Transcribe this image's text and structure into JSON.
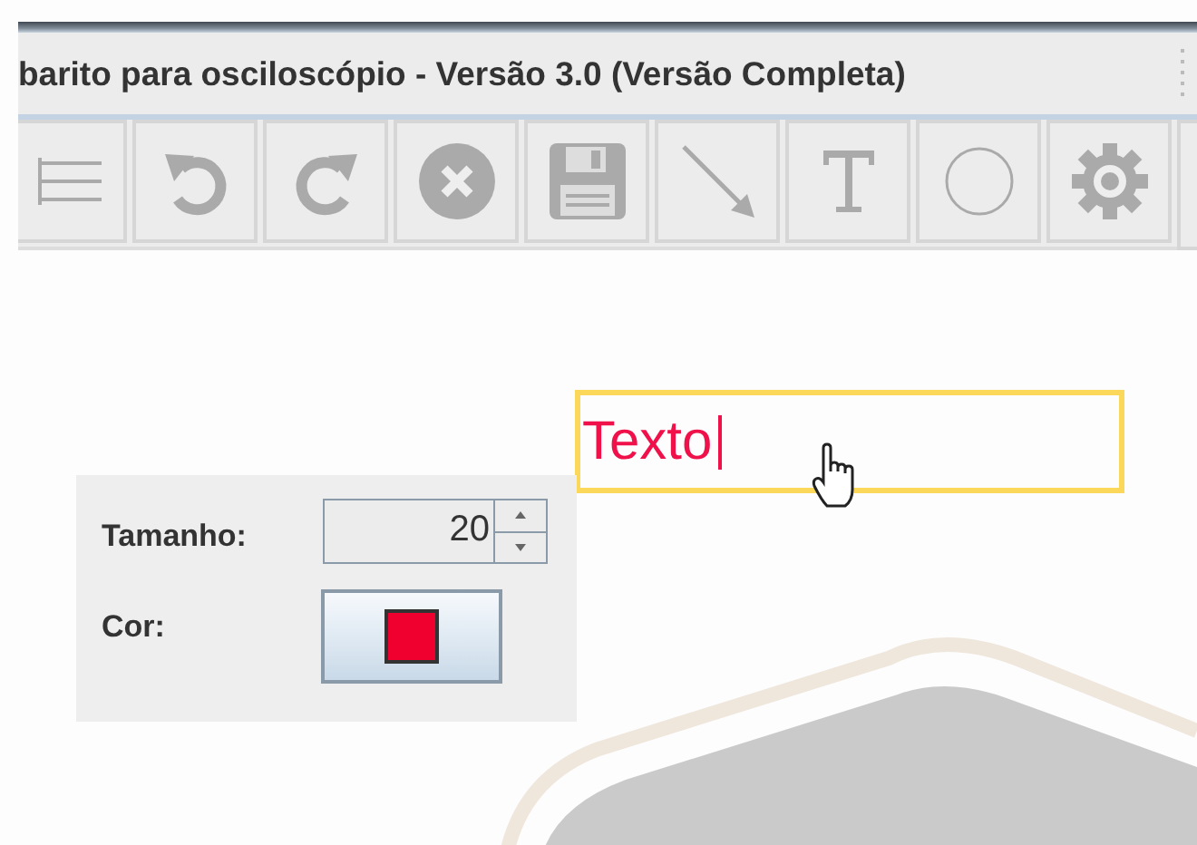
{
  "window": {
    "title": "barito para osciloscópio - Versão 3.0 (Versão Completa)"
  },
  "canvas": {
    "text_field": {
      "value": "Texto"
    }
  },
  "properties_panel": {
    "size_label": "Tamanho:",
    "size_value": "20",
    "color_label": "Cor:",
    "color": "#f0002f"
  }
}
